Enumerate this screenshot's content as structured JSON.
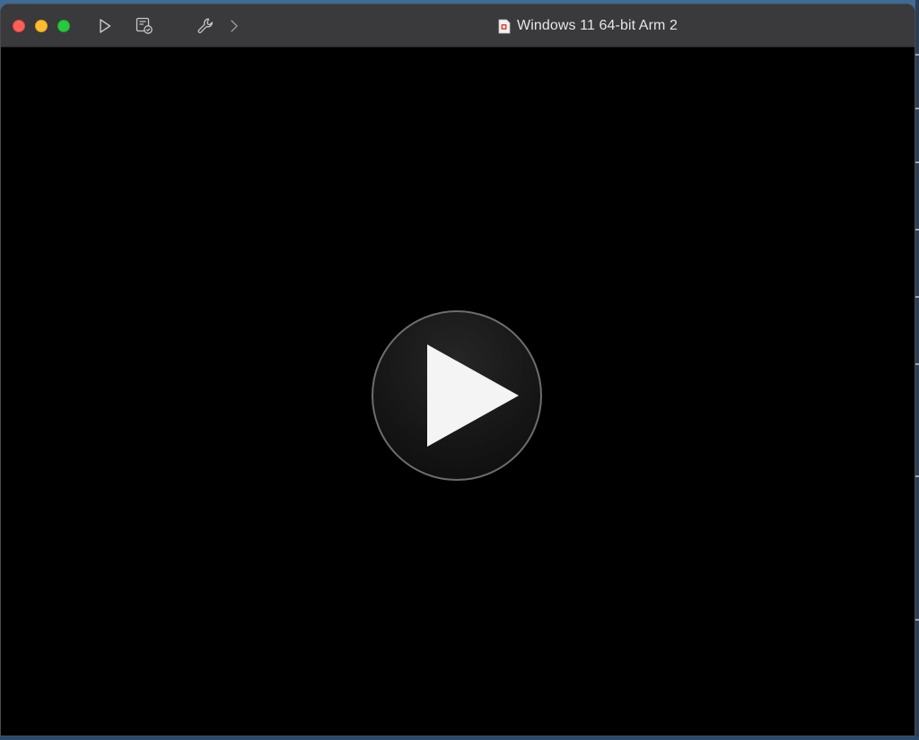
{
  "window": {
    "title": "Windows 11 64-bit Arm 2"
  },
  "toolbar": {
    "buttons": [
      {
        "name": "start-vm",
        "icon": "play-outline-icon"
      },
      {
        "name": "snapshot",
        "icon": "snapshot-icon"
      },
      {
        "name": "settings",
        "icon": "wrench-icon"
      },
      {
        "name": "more",
        "icon": "chevron-right-icon"
      }
    ]
  },
  "traffic_lights": {
    "close": "#ff5f57",
    "minimize": "#febc2e",
    "zoom": "#28c840"
  },
  "screen": {
    "state": "powered-off",
    "center_button_icon": "play-icon"
  }
}
